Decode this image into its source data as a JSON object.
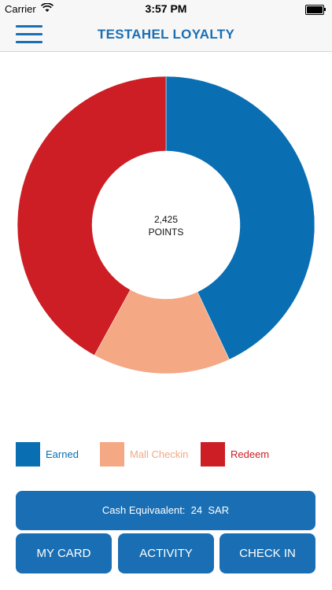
{
  "status_bar": {
    "carrier": "Carrier",
    "time": "3:57 PM",
    "wifi_icon": "wifi-icon",
    "battery_icon": "battery-icon"
  },
  "nav": {
    "title": "TESTAHEL LOYALTY",
    "menu_icon": "hamburger-menu-icon"
  },
  "colors": {
    "primary": "#1a6fb4",
    "earned": "#0a6eb3",
    "mall_checkin": "#f4a883",
    "redeem": "#cc1e24"
  },
  "chart_data": {
    "type": "pie",
    "donut": true,
    "center_text": [
      "2,425",
      "POINTS"
    ],
    "categories": [
      "Earned",
      "Mall Checkin",
      "Redeem"
    ],
    "values": [
      43,
      15,
      42
    ],
    "colors": [
      "#0a6eb3",
      "#f4a883",
      "#cc1e24"
    ],
    "legend_position": "bottom"
  },
  "legend": [
    {
      "label": "Earned",
      "color": "#0a6eb3"
    },
    {
      "label": "Mall Checkin",
      "color": "#f4a883"
    },
    {
      "label": "Redeem",
      "color": "#cc1e24"
    }
  ],
  "cash": {
    "label": "Cash Equivaalent:",
    "amount": "24",
    "currency": "SAR"
  },
  "buttons": {
    "my_card": "MY CARD",
    "activity": "ACTIVITY",
    "check_in": "CHECK IN"
  }
}
